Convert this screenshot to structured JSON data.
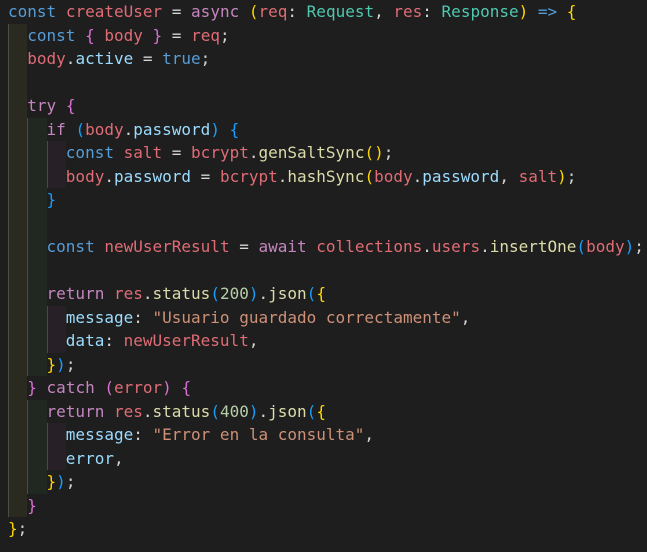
{
  "editor": {
    "language": "typescript",
    "lines": [
      {
        "indent": 0,
        "tokens": [
          [
            "kw",
            "const"
          ],
          [
            "pun",
            " "
          ],
          [
            "lv",
            "createUser"
          ],
          [
            "pun",
            " = "
          ],
          [
            "ctl",
            "async"
          ],
          [
            "pun",
            " "
          ],
          [
            "br1",
            "("
          ],
          [
            "pr",
            "req"
          ],
          [
            "pun",
            ": "
          ],
          [
            "typ",
            "Request"
          ],
          [
            "pun",
            ", "
          ],
          [
            "pr",
            "res"
          ],
          [
            "pun",
            ": "
          ],
          [
            "typ",
            "Response"
          ],
          [
            "br1",
            ")"
          ],
          [
            "pun",
            " "
          ],
          [
            "kw",
            "=>"
          ],
          [
            "pun",
            " "
          ],
          [
            "br1",
            "{"
          ]
        ]
      },
      {
        "indent": 1,
        "tokens": [
          [
            "kw",
            "const"
          ],
          [
            "pun",
            " "
          ],
          [
            "br2",
            "{"
          ],
          [
            "pun",
            " "
          ],
          [
            "lv",
            "body"
          ],
          [
            "pun",
            " "
          ],
          [
            "br2",
            "}"
          ],
          [
            "pun",
            " = "
          ],
          [
            "lv",
            "req"
          ],
          [
            "pun",
            ";"
          ]
        ]
      },
      {
        "indent": 1,
        "tokens": [
          [
            "lv",
            "body"
          ],
          [
            "pun",
            "."
          ],
          [
            "var",
            "active"
          ],
          [
            "pun",
            " = "
          ],
          [
            "kw",
            "true"
          ],
          [
            "pun",
            ";"
          ]
        ]
      },
      {
        "indent": 0,
        "tokens": []
      },
      {
        "indent": 1,
        "tokens": [
          [
            "ctl",
            "try"
          ],
          [
            "pun",
            " "
          ],
          [
            "br2",
            "{"
          ]
        ]
      },
      {
        "indent": 2,
        "tokens": [
          [
            "ctl",
            "if"
          ],
          [
            "pun",
            " "
          ],
          [
            "br3",
            "("
          ],
          [
            "lv",
            "body"
          ],
          [
            "pun",
            "."
          ],
          [
            "var",
            "password"
          ],
          [
            "br3",
            ")"
          ],
          [
            "pun",
            " "
          ],
          [
            "br3",
            "{"
          ]
        ]
      },
      {
        "indent": 3,
        "tokens": [
          [
            "kw",
            "const"
          ],
          [
            "pun",
            " "
          ],
          [
            "lv",
            "salt"
          ],
          [
            "pun",
            " = "
          ],
          [
            "lv",
            "bcrypt"
          ],
          [
            "pun",
            "."
          ],
          [
            "fn",
            "genSaltSync"
          ],
          [
            "br1",
            "()"
          ],
          [
            "pun",
            ";"
          ]
        ]
      },
      {
        "indent": 3,
        "tokens": [
          [
            "lv",
            "body"
          ],
          [
            "pun",
            "."
          ],
          [
            "var",
            "password"
          ],
          [
            "pun",
            " = "
          ],
          [
            "lv",
            "bcrypt"
          ],
          [
            "pun",
            "."
          ],
          [
            "fn",
            "hashSync"
          ],
          [
            "br1",
            "("
          ],
          [
            "lv",
            "body"
          ],
          [
            "pun",
            "."
          ],
          [
            "var",
            "password"
          ],
          [
            "pun",
            ", "
          ],
          [
            "lv",
            "salt"
          ],
          [
            "br1",
            ")"
          ],
          [
            "pun",
            ";"
          ]
        ]
      },
      {
        "indent": 2,
        "tokens": [
          [
            "br3",
            "}"
          ]
        ]
      },
      {
        "indent": 0,
        "tokens": []
      },
      {
        "indent": 2,
        "tokens": [
          [
            "kw",
            "const"
          ],
          [
            "pun",
            " "
          ],
          [
            "lv",
            "newUserResult"
          ],
          [
            "pun",
            " = "
          ],
          [
            "ctl",
            "await"
          ],
          [
            "pun",
            " "
          ],
          [
            "lv",
            "collections"
          ],
          [
            "pun",
            "."
          ],
          [
            "lv",
            "users"
          ],
          [
            "pun",
            "."
          ],
          [
            "fn",
            "insertOne"
          ],
          [
            "br3",
            "("
          ],
          [
            "lv",
            "body"
          ],
          [
            "br3",
            ")"
          ],
          [
            "pun",
            ";"
          ]
        ]
      },
      {
        "indent": 0,
        "tokens": []
      },
      {
        "indent": 2,
        "tokens": [
          [
            "ctl",
            "return"
          ],
          [
            "pun",
            " "
          ],
          [
            "lv",
            "res"
          ],
          [
            "pun",
            "."
          ],
          [
            "fn",
            "status"
          ],
          [
            "br3",
            "("
          ],
          [
            "num",
            "200"
          ],
          [
            "br3",
            ")"
          ],
          [
            "pun",
            "."
          ],
          [
            "fn",
            "json"
          ],
          [
            "br3",
            "("
          ],
          [
            "br1",
            "{"
          ]
        ]
      },
      {
        "indent": 3,
        "tokens": [
          [
            "var",
            "message"
          ],
          [
            "pun",
            ": "
          ],
          [
            "str",
            "\"Usuario guardado correctamente\""
          ],
          [
            "pun",
            ","
          ]
        ]
      },
      {
        "indent": 3,
        "tokens": [
          [
            "var",
            "data"
          ],
          [
            "pun",
            ": "
          ],
          [
            "lv",
            "newUserResult"
          ],
          [
            "pun",
            ","
          ]
        ]
      },
      {
        "indent": 2,
        "tokens": [
          [
            "br1",
            "}"
          ],
          [
            "br3",
            ")"
          ],
          [
            "pun",
            ";"
          ]
        ]
      },
      {
        "indent": 1,
        "tokens": [
          [
            "br2",
            "}"
          ],
          [
            "pun",
            " "
          ],
          [
            "ctl",
            "catch"
          ],
          [
            "pun",
            " "
          ],
          [
            "br2",
            "("
          ],
          [
            "lv",
            "error"
          ],
          [
            "br2",
            ")"
          ],
          [
            "pun",
            " "
          ],
          [
            "br2",
            "{"
          ]
        ]
      },
      {
        "indent": 2,
        "tokens": [
          [
            "ctl",
            "return"
          ],
          [
            "pun",
            " "
          ],
          [
            "lv",
            "res"
          ],
          [
            "pun",
            "."
          ],
          [
            "fn",
            "status"
          ],
          [
            "br3",
            "("
          ],
          [
            "num",
            "400"
          ],
          [
            "br3",
            ")"
          ],
          [
            "pun",
            "."
          ],
          [
            "fn",
            "json"
          ],
          [
            "br3",
            "("
          ],
          [
            "br1",
            "{"
          ]
        ]
      },
      {
        "indent": 3,
        "tokens": [
          [
            "var",
            "message"
          ],
          [
            "pun",
            ": "
          ],
          [
            "str",
            "\"Error en la consulta\""
          ],
          [
            "pun",
            ","
          ]
        ]
      },
      {
        "indent": 3,
        "tokens": [
          [
            "var",
            "error"
          ],
          [
            "pun",
            ","
          ]
        ]
      },
      {
        "indent": 2,
        "tokens": [
          [
            "br1",
            "}"
          ],
          [
            "br3",
            ")"
          ],
          [
            "pun",
            ";"
          ]
        ]
      },
      {
        "indent": 1,
        "tokens": [
          [
            "br2",
            "}"
          ]
        ]
      },
      {
        "indent": 0,
        "tokens": [
          [
            "br1",
            "}"
          ],
          [
            "pun",
            ";"
          ]
        ]
      }
    ]
  }
}
